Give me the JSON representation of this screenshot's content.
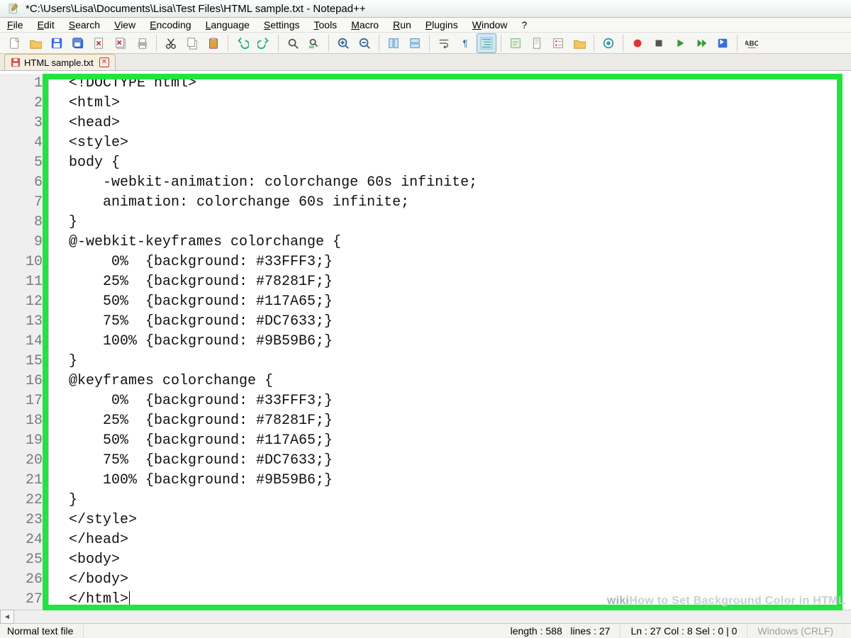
{
  "window": {
    "title": "*C:\\Users\\Lisa\\Documents\\Lisa\\Test Files\\HTML sample.txt - Notepad++"
  },
  "menu": {
    "items": [
      "File",
      "Edit",
      "Search",
      "View",
      "Encoding",
      "Language",
      "Settings",
      "Tools",
      "Macro",
      "Run",
      "Plugins",
      "Window",
      "?"
    ]
  },
  "tab": {
    "filename": "HTML sample.txt"
  },
  "code": {
    "lines": [
      "<!DOCTYPE html>",
      "<html>",
      "<head>",
      "<style>",
      "body {",
      "    -webkit-animation: colorchange 60s infinite;",
      "    animation: colorchange 60s infinite;",
      "}",
      "@-webkit-keyframes colorchange {",
      "     0%  {background: #33FFF3;}",
      "    25%  {background: #78281F;}",
      "    50%  {background: #117A65;}",
      "    75%  {background: #DC7633;}",
      "    100% {background: #9B59B6;}",
      "}",
      "@keyframes colorchange {",
      "     0%  {background: #33FFF3;}",
      "    25%  {background: #78281F;}",
      "    50%  {background: #117A65;}",
      "    75%  {background: #DC7633;}",
      "    100% {background: #9B59B6;}",
      "}",
      "</style>",
      "</head>",
      "<body>",
      "</body>",
      "</html>"
    ]
  },
  "status": {
    "filetype": "Normal text file",
    "length_label": "length : 588",
    "lines_label": "lines : 27",
    "pos": "Ln : 27   Col : 8   Sel : 0 | 0",
    "eol": "Windows (CRLF)"
  },
  "watermark": {
    "prefix": "wiki",
    "text": "How to Set Background Color in HTML"
  },
  "icons": {
    "app": "notepadpp-icon",
    "toolbar_groups": [
      [
        "new-file-icon",
        "open-file-icon",
        "save-icon",
        "save-all-icon",
        "close-icon",
        "close-all-icon",
        "print-icon"
      ],
      [
        "cut-icon",
        "copy-icon",
        "paste-icon"
      ],
      [
        "undo-icon",
        "redo-icon"
      ],
      [
        "find-icon",
        "replace-icon"
      ],
      [
        "zoom-in-icon",
        "zoom-out-icon"
      ],
      [
        "sync-v-icon",
        "sync-h-icon"
      ],
      [
        "wordwrap-icon",
        "show-all-chars-icon",
        "indent-guide-icon"
      ],
      [
        "user-lang-icon",
        "doc-map-icon",
        "func-list-icon",
        "folder-icon"
      ],
      [
        "monitor-icon"
      ],
      [
        "record-macro-icon",
        "stop-macro-icon",
        "play-macro-icon",
        "run-multi-icon",
        "save-macro-icon"
      ],
      [
        "spellcheck-icon"
      ]
    ]
  }
}
